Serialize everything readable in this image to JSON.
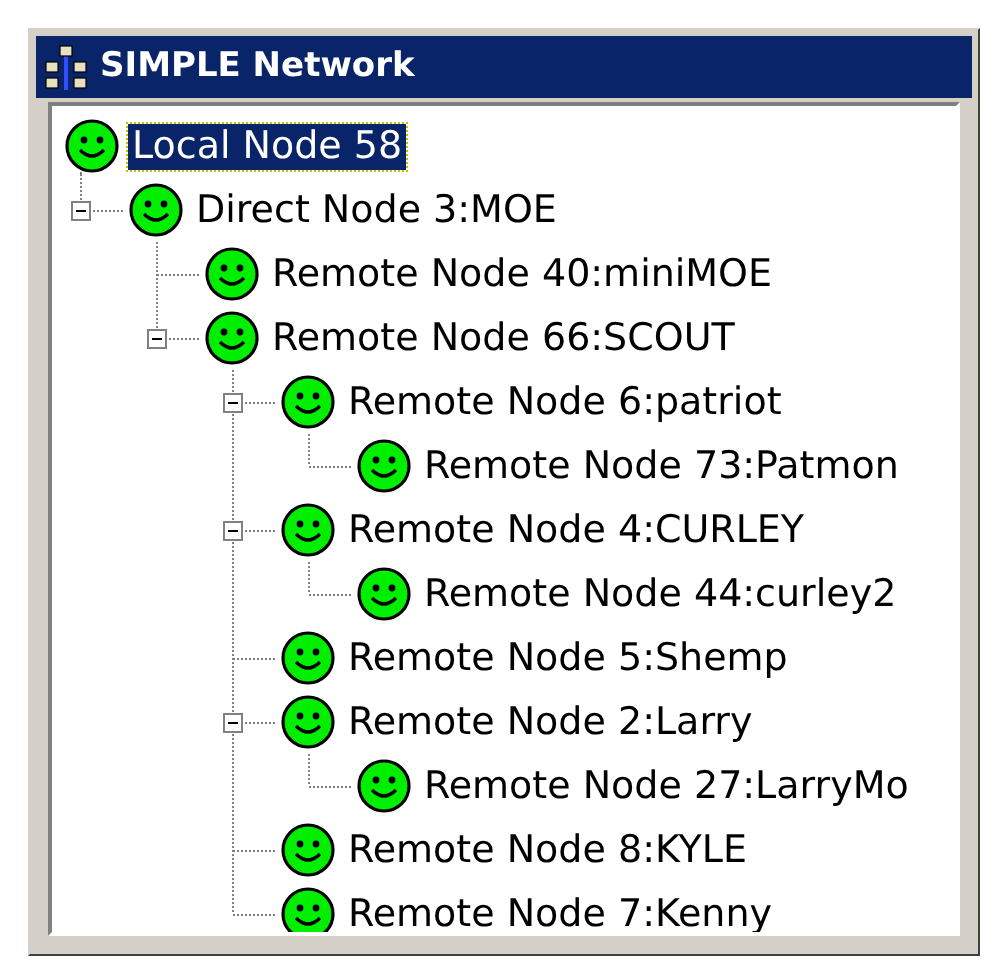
{
  "window": {
    "title": "SIMPLE Network"
  },
  "tree": {
    "nodes": [
      {
        "label": "Local Node 58",
        "selected": true,
        "expanded": true,
        "children": [
          {
            "label": "Direct Node 3:MOE",
            "selected": false,
            "expanded": true,
            "children": [
              {
                "label": "Remote Node 40:miniMOE",
                "selected": false
              },
              {
                "label": "Remote Node 66:SCOUT",
                "selected": false,
                "expanded": true,
                "children": [
                  {
                    "label": "Remote Node 6:patriot",
                    "selected": false,
                    "expanded": true,
                    "children": [
                      {
                        "label": "Remote Node 73:Patmon",
                        "selected": false
                      }
                    ]
                  },
                  {
                    "label": "Remote Node 4:CURLEY",
                    "selected": false,
                    "expanded": true,
                    "children": [
                      {
                        "label": "Remote Node 44:curley2",
                        "selected": false
                      }
                    ]
                  },
                  {
                    "label": "Remote Node 5:Shemp",
                    "selected": false
                  },
                  {
                    "label": "Remote Node 2:Larry",
                    "selected": false,
                    "expanded": true,
                    "children": [
                      {
                        "label": "Remote Node 27:LarryMo",
                        "selected": false
                      }
                    ]
                  },
                  {
                    "label": "Remote Node 8:KYLE",
                    "selected": false
                  },
                  {
                    "label": "Remote Node 7:Kenny",
                    "selected": false
                  }
                ]
              }
            ]
          }
        ]
      }
    ]
  }
}
